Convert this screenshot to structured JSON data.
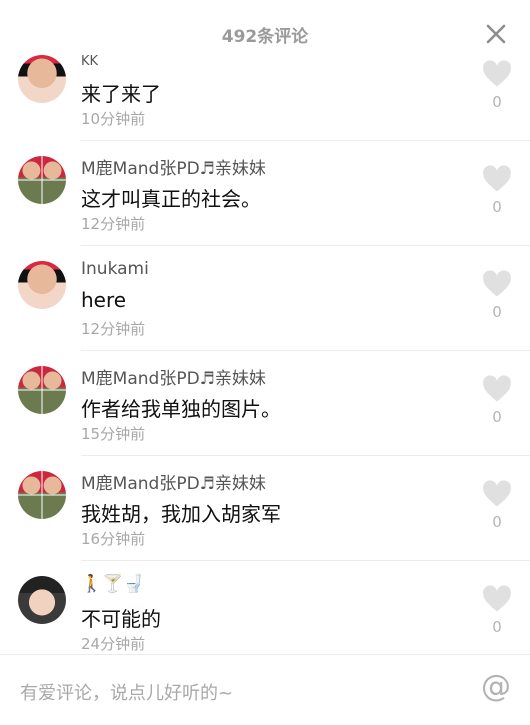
{
  "header": {
    "title": "492条评论"
  },
  "comments": [
    {
      "user": "KK",
      "text": "来了来了",
      "time": "10分钟前",
      "likes": "0"
    },
    {
      "user": "M鹿Mand张PD♬亲妹妹",
      "text": "这才叫真正的社会。",
      "time": "12分钟前",
      "likes": "0"
    },
    {
      "user": "Inukami",
      "text": "here",
      "time": "12分钟前",
      "likes": "0"
    },
    {
      "user": "M鹿Mand张PD♬亲妹妹",
      "text": "作者给我单独的图片。",
      "time": "15分钟前",
      "likes": "0"
    },
    {
      "user": "M鹿Mand张PD♬亲妹妹",
      "text": "我姓胡，我加入胡家军",
      "time": "16分钟前",
      "likes": "0"
    },
    {
      "user": "🚶🍸🚽",
      "text": "不可能的",
      "time": "24分钟前",
      "likes": "0"
    }
  ],
  "input": {
    "placeholder": "有爱评论，说点儿好听的~",
    "at_symbol": "@"
  },
  "colors": {
    "muted": "#a8a8a8",
    "text": "#111111",
    "divider": "#ececec"
  },
  "icons": {
    "close": "close-icon",
    "like": "heart-icon",
    "mention": "at-icon"
  }
}
